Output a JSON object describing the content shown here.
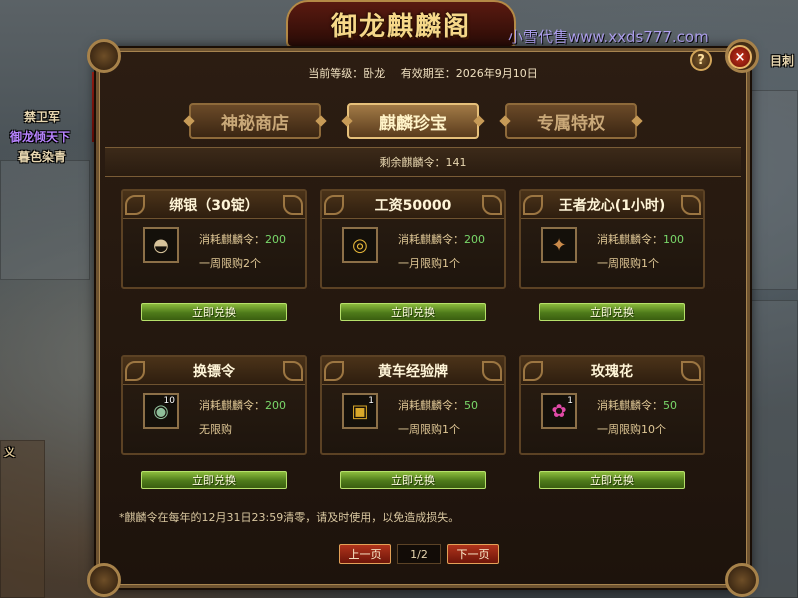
{
  "background": {
    "npc_labels": [
      {
        "text": "禁卫军",
        "color": "#ffffff"
      },
      {
        "text": "御龙倾天下",
        "color": "#b884ff"
      },
      {
        "text": "暮色染青",
        "color": "#ffffff"
      },
      {
        "text": "目刺",
        "color": "#ffffff"
      },
      {
        "text": "义",
        "color": "#e0c896"
      }
    ]
  },
  "dialog": {
    "title": "御龙麒麟阁",
    "watermark": "小雪代售www.xxds777.com",
    "level_label": "当前等级：卧龙",
    "valid_label": "有效期至：2026年9月10日",
    "help_label": "?",
    "close_label": "×",
    "tabs": [
      {
        "label": "神秘商店",
        "active": false
      },
      {
        "label": "麒麟珍宝",
        "active": true
      },
      {
        "label": "专属特权",
        "active": false
      }
    ],
    "remaining": "剩余麒麟令：141",
    "cost_prefix": "消耗麒麟令：",
    "exchange_label": "立即兑换",
    "items": [
      {
        "name": "绑银（30锭）",
        "icon": "silver-ingot-icon",
        "glyph": "◓",
        "qty": "",
        "cost": "200",
        "limit": "一周限购2个"
      },
      {
        "name": "工资50000",
        "icon": "gold-coins-icon",
        "glyph": "◎",
        "qty": "",
        "cost": "200",
        "limit": "一月限购1个"
      },
      {
        "name": "王者龙心(1小时)",
        "icon": "dragon-heart-icon",
        "glyph": "✦",
        "qty": "",
        "cost": "100",
        "limit": "一周限购1个"
      },
      {
        "name": "换镖令",
        "icon": "escort-token-icon",
        "glyph": "◉",
        "qty": "10",
        "cost": "200",
        "limit": "无限购"
      },
      {
        "name": "黄车经验牌",
        "icon": "cart-exp-card-icon",
        "glyph": "▣",
        "qty": "1",
        "cost": "50",
        "limit": "一周限购1个"
      },
      {
        "name": "玫瑰花",
        "icon": "rose-icon",
        "glyph": "✿",
        "qty": "1",
        "cost": "50",
        "limit": "一周限购10个"
      }
    ],
    "footnote": "*麒麟令在每年的12月31日23:59清零，请及时使用，以免造成损失。",
    "pager": {
      "prev": "上一页",
      "indicator": "1/2",
      "next": "下一页"
    }
  }
}
